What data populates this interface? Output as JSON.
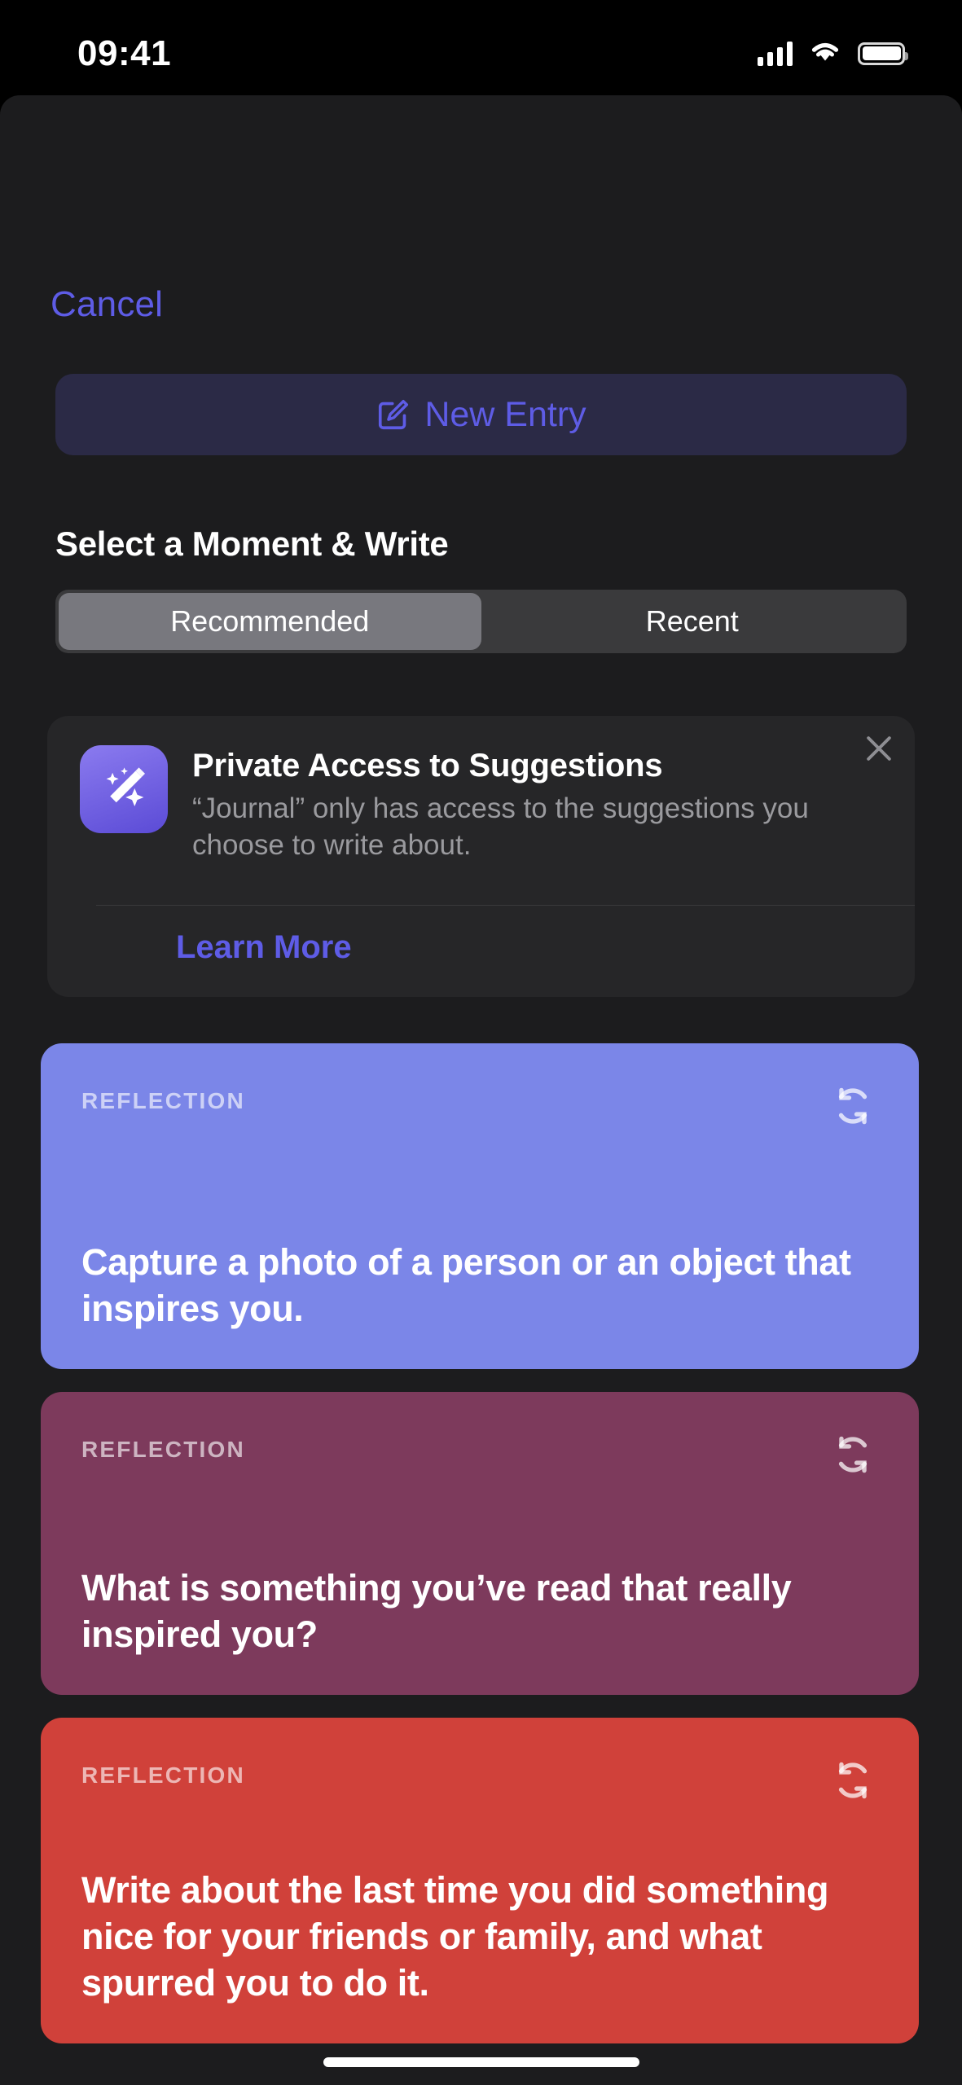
{
  "status_bar": {
    "time": "09:41",
    "cellular_icon": "cellular-bars-icon",
    "wifi_icon": "wifi-icon",
    "battery_icon": "battery-icon"
  },
  "sheet": {
    "cancel_label": "Cancel",
    "new_entry": {
      "label": "New Entry",
      "icon": "square-and-pencil-icon",
      "accent_color": "#5E5CE6",
      "background_color": "#2B2A46"
    },
    "section_title": "Select a Moment & Write",
    "segmented_control": {
      "options": [
        {
          "label": "Recommended",
          "selected": true
        },
        {
          "label": "Recent",
          "selected": false
        }
      ],
      "track_color": "#3A3A3C",
      "selected_color": "#78787E"
    },
    "privacy_card": {
      "icon": "magic-wand-sparkles-icon",
      "title": "Private Access to Suggestions",
      "description": "“Journal” only has access to the suggestions you choose to write about.",
      "learn_more_label": "Learn More",
      "close_icon": "close-icon",
      "accent_color": "#5E5CE6"
    },
    "suggestion_cards": [
      {
        "kicker": "REFLECTION",
        "prompt": "Capture a photo of a person or an object that inspires you.",
        "color": "#7B86E8",
        "refresh_icon": "refresh-cycle-icon"
      },
      {
        "kicker": "REFLECTION",
        "prompt": "What is something you’ve read that really inspired you?",
        "color": "#7D3A5C",
        "refresh_icon": "refresh-cycle-icon"
      },
      {
        "kicker": "REFLECTION",
        "prompt": "Write about the last time you did something nice for your friends or family, and what spurred you to do it.",
        "color": "#D0413A",
        "refresh_icon": "refresh-cycle-icon"
      }
    ]
  },
  "home_indicator": "home-indicator"
}
